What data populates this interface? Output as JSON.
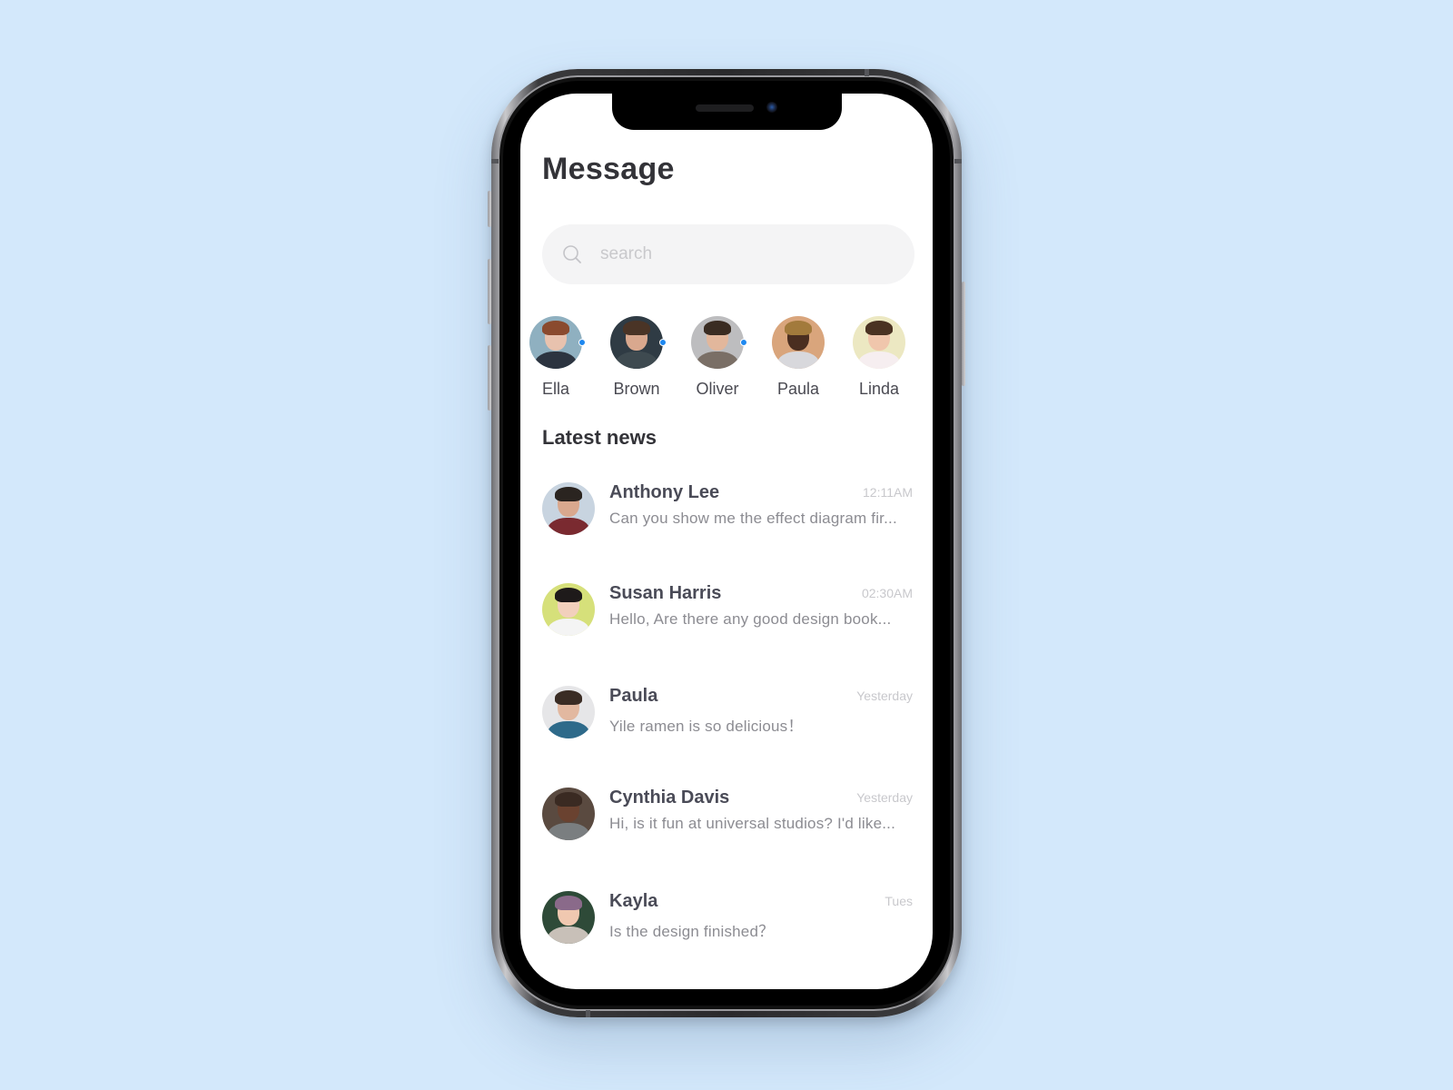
{
  "screen": {
    "title": "Message",
    "search": {
      "placeholder": "search",
      "value": "",
      "icon": "search-icon"
    },
    "stories": [
      {
        "name": "Ella",
        "online": true,
        "colors": {
          "bg": "#8fb0c0",
          "skin": "#e8c2ae",
          "hair": "#8a4a2e",
          "body": "#2c3440"
        }
      },
      {
        "name": "Brown",
        "online": true,
        "colors": {
          "bg": "#2f3b44",
          "skin": "#d9a88e",
          "hair": "#4a3426",
          "body": "#3e4a50"
        }
      },
      {
        "name": "Oliver",
        "online": true,
        "colors": {
          "bg": "#bdbdbf",
          "skin": "#e2b79c",
          "hair": "#3a2c22",
          "body": "#7a6f66"
        }
      },
      {
        "name": "Paula",
        "online": false,
        "colors": {
          "bg": "#d9a57c",
          "skin": "#4a2e20",
          "hair": "#a27a3c",
          "body": "#d8d8dc"
        }
      },
      {
        "name": "Linda",
        "online": false,
        "colors": {
          "bg": "#ece8c2",
          "skin": "#f0c6ac",
          "hair": "#4a3222",
          "body": "#f6eef0"
        }
      }
    ],
    "section_title": "Latest news",
    "messages": [
      {
        "name": "Anthony Lee",
        "time": "12:11AM",
        "preview": "Can you show me the effect diagram fir...",
        "colors": {
          "bg": "#c8d4e0",
          "skin": "#d9a88e",
          "hair": "#2a2420",
          "body": "#7a2a30"
        }
      },
      {
        "name": "Susan Harris",
        "time": "02:30AM",
        "preview": "Hello,  Are there any good design book...",
        "colors": {
          "bg": "#d6e07a",
          "skin": "#f2d0bc",
          "hair": "#1e1a1a",
          "body": "#f4f4f4"
        }
      },
      {
        "name": "Paula",
        "time": "Yesterday",
        "preview": "Yile ramen is so delicious！",
        "colors": {
          "bg": "#e6e6e8",
          "skin": "#e2b8a0",
          "hair": "#3a2c24",
          "body": "#2e6a8a"
        }
      },
      {
        "name": "Cynthia Davis",
        "time": "Yesterday",
        "preview": "Hi, is it fun at universal studios? I'd like...",
        "colors": {
          "bg": "#5a4a40",
          "skin": "#6a4230",
          "hair": "#3a2a22",
          "body": "#7a7e80"
        }
      },
      {
        "name": "Kayla",
        "time": "Tues",
        "preview": "Is the design finished？",
        "colors": {
          "bg": "#2e4a38",
          "skin": "#f0c8b0",
          "hair": "#8a6a8a",
          "body": "#c8c0b8"
        }
      }
    ]
  },
  "theme": {
    "background": "#d3e8fb",
    "online_dot": "#1e88f0",
    "title_color": "#333338",
    "name_color": "#4a4b57",
    "preview_color": "#8c8c92",
    "time_color": "#c8c8cc",
    "search_bg": "#f4f4f5"
  }
}
